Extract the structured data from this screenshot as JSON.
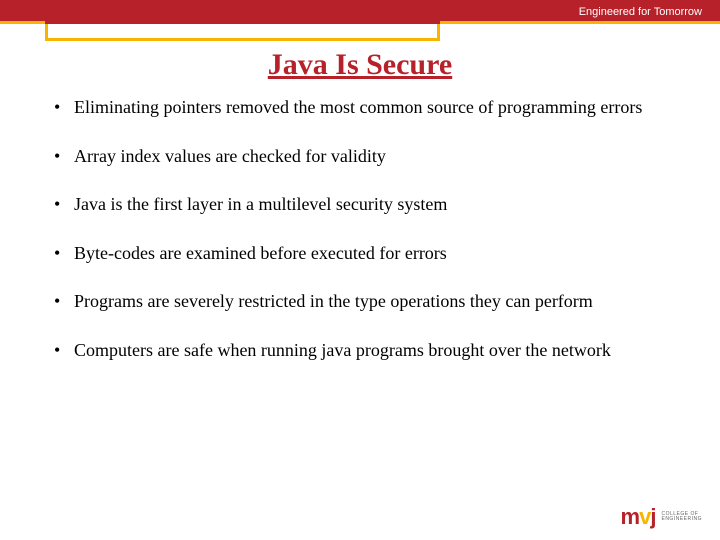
{
  "header": {
    "tagline": "Engineered for Tomorrow"
  },
  "title": "Java Is Secure",
  "bullets": [
    "Eliminating pointers removed the most common source of programming errors",
    "Array index values are checked for validity",
    "Java is the first layer in a multilevel security system",
    "Byte-codes are examined before executed for errors",
    "Programs are severely restricted in the type operations they can perform",
    "Computers are safe when running java programs brought over the network"
  ],
  "logo": {
    "m": "m",
    "v": "v",
    "j": "j",
    "sub1": "COLLEGE OF",
    "sub2": "ENGINEERING"
  }
}
